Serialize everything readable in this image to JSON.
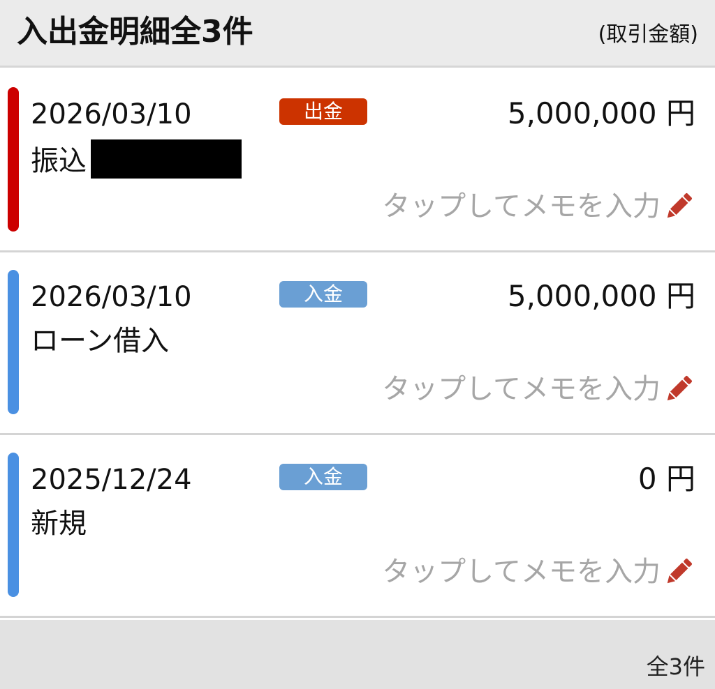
{
  "header": {
    "title": "入出金明細全3件",
    "subtitle": "(取引金額)"
  },
  "transactions": [
    {
      "date": "2026/03/10",
      "description": "振込",
      "description_redacted": true,
      "type_label": "出金",
      "type": "withdrawal",
      "amount": "5,000,000 円",
      "memo_placeholder": "タップしてメモを入力",
      "bar_color": "#cc0000",
      "badge_color": "#cc3300"
    },
    {
      "date": "2026/03/10",
      "description": "ローン借入",
      "description_redacted": false,
      "type_label": "入金",
      "type": "deposit",
      "amount": "5,000,000 円",
      "memo_placeholder": "タップしてメモを入力",
      "bar_color": "#4a90e2",
      "badge_color": "#6a9fd4"
    },
    {
      "date": "2025/12/24",
      "description": "新規",
      "description_redacted": false,
      "type_label": "入金",
      "type": "deposit",
      "amount": "0 円",
      "memo_placeholder": "タップしてメモを入力",
      "bar_color": "#4a90e2",
      "badge_color": "#6a9fd4"
    }
  ],
  "icons": {
    "memo_edit": "pencil-icon"
  },
  "colors": {
    "pencil": "#c0392b",
    "memo_text": "#a6a6a6"
  },
  "footer": {
    "count_label": "全3件"
  }
}
